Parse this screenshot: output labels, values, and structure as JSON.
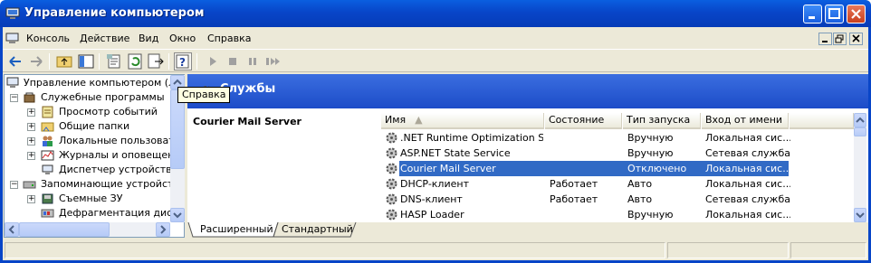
{
  "window": {
    "title": "Управление компьютером"
  },
  "menu": [
    "Консоль",
    "Действие",
    "Вид",
    "Окно",
    "Справка"
  ],
  "tooltip": "Справка",
  "tree": [
    {
      "label": "Управление компьютером (лок",
      "level": 0,
      "expander": ""
    },
    {
      "label": "Служебные программы",
      "level": 1,
      "expander": "−"
    },
    {
      "label": "Просмотр событий",
      "level": 2,
      "expander": "+"
    },
    {
      "label": "Общие папки",
      "level": 2,
      "expander": "+"
    },
    {
      "label": "Локальные пользовате.",
      "level": 2,
      "expander": "+"
    },
    {
      "label": "Журналы и оповещения",
      "level": 2,
      "expander": "+"
    },
    {
      "label": "Диспетчер устройств",
      "level": 2,
      "expander": ""
    },
    {
      "label": "Запоминающие устройства",
      "level": 1,
      "expander": "−"
    },
    {
      "label": "Съемные ЗУ",
      "level": 2,
      "expander": "+"
    },
    {
      "label": "Дефрагментация диска",
      "level": 2,
      "expander": ""
    }
  ],
  "banner": {
    "title": "Службы"
  },
  "detail": {
    "selected_name": "Courier Mail Server"
  },
  "columns": [
    "Имя",
    "Состояние",
    "Тип запуска",
    "Вход от имени"
  ],
  "services": [
    {
      "name": ".NET Runtime Optimization Ser...",
      "state": "",
      "startup": "Вручную",
      "logon": "Локальная сис..."
    },
    {
      "name": "ASP.NET State Service",
      "state": "",
      "startup": "Вручную",
      "logon": "Сетевая служба"
    },
    {
      "name": "Courier Mail Server",
      "state": "",
      "startup": "Отключено",
      "logon": "Локальная сис...",
      "selected": true
    },
    {
      "name": "DHCP-клиент",
      "state": "Работает",
      "startup": "Авто",
      "logon": "Локальная сис..."
    },
    {
      "name": "DNS-клиент",
      "state": "Работает",
      "startup": "Авто",
      "logon": "Сетевая служба"
    },
    {
      "name": "HASP Loader",
      "state": "",
      "startup": "Вручную",
      "logon": "Локальная сис..."
    }
  ],
  "tabs": [
    "Расширенный",
    "Стандартный"
  ],
  "colors": {
    "titlebar": "#0845c8",
    "banner": "#1c4cc8",
    "selection": "#316ac5",
    "chrome": "#ece9d8"
  }
}
